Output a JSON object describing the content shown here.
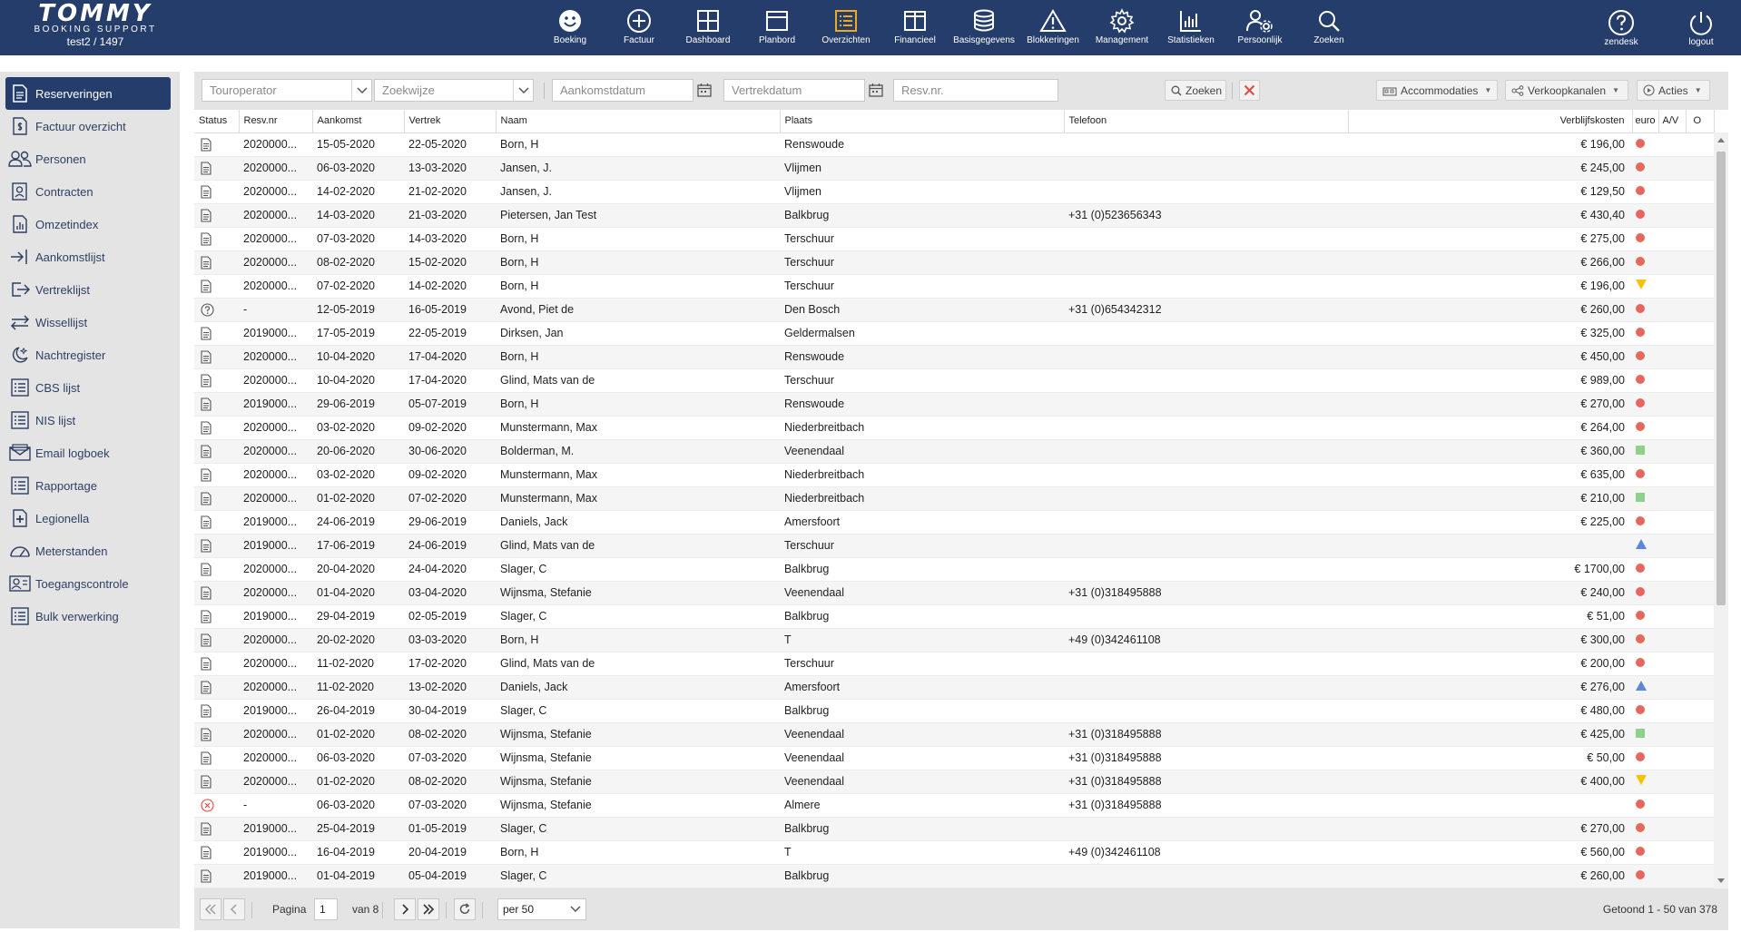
{
  "app": {
    "logo_title": "TOMMY",
    "logo_subtitle": "BOOKING SUPPORT",
    "user": "test2 / 1497"
  },
  "nav": [
    {
      "label": "Boeking",
      "icon": "smiley-icon"
    },
    {
      "label": "Factuur",
      "icon": "plus-circle-icon"
    },
    {
      "label": "Dashboard",
      "icon": "grid-icon"
    },
    {
      "label": "Planbord",
      "icon": "planbord-icon"
    },
    {
      "label": "Overzichten",
      "icon": "list-icon",
      "active": true
    },
    {
      "label": "Financieel",
      "icon": "columns-icon"
    },
    {
      "label": "Basisgegevens",
      "icon": "database-icon"
    },
    {
      "label": "Blokkeringen",
      "icon": "warning-icon"
    },
    {
      "label": "Management",
      "icon": "gear-icon"
    },
    {
      "label": "Statistieken",
      "icon": "bar-chart-icon"
    },
    {
      "label": "Persoonlijk",
      "icon": "person-gear-icon"
    },
    {
      "label": "Zoeken",
      "icon": "search-icon"
    }
  ],
  "nav_right": [
    {
      "label": "zendesk",
      "icon": "help-icon"
    },
    {
      "label": "logout",
      "icon": "power-icon"
    }
  ],
  "sidebar": [
    {
      "label": "Reserveringen",
      "icon": "document-icon",
      "active": true
    },
    {
      "label": "Factuur overzicht",
      "icon": "invoice-icon"
    },
    {
      "label": "Personen",
      "icon": "people-icon"
    },
    {
      "label": "Contracten",
      "icon": "contract-icon"
    },
    {
      "label": "Omzetindex",
      "icon": "chart-doc-icon"
    },
    {
      "label": "Aankomstlijst",
      "icon": "arrival-icon"
    },
    {
      "label": "Vertreklijst",
      "icon": "departure-icon"
    },
    {
      "label": "Wissellijst",
      "icon": "swap-icon"
    },
    {
      "label": "Nachtregister",
      "icon": "night-icon"
    },
    {
      "label": "CBS lijst",
      "icon": "list-icon"
    },
    {
      "label": "NIS lijst",
      "icon": "list-icon"
    },
    {
      "label": "Email logboek",
      "icon": "email-icon"
    },
    {
      "label": "Rapportage",
      "icon": "list-icon"
    },
    {
      "label": "Legionella",
      "icon": "plus-doc-icon"
    },
    {
      "label": "Meterstanden",
      "icon": "gauge-icon"
    },
    {
      "label": "Toegangscontrole",
      "icon": "access-icon"
    },
    {
      "label": "Bulk verwerking",
      "icon": "list-icon"
    }
  ],
  "filters": {
    "touroperator": "Touroperator",
    "zoekwijze": "Zoekwijze",
    "aankomstdatum": "Aankomstdatum",
    "vertrekdatum": "Vertrekdatum",
    "resvnr": "Resv.nr.",
    "zoeken": "Zoeken",
    "accommodaties": "Accommodaties",
    "verkoopkanalen": "Verkoopkanalen",
    "acties": "Acties"
  },
  "columns": {
    "status": "Status",
    "resvnr": "Resv.nr",
    "aankomst": "Aankomst",
    "vertrek": "Vertrek",
    "naam": "Naam",
    "plaats": "Plaats",
    "telefoon": "Telefoon",
    "verblijfskosten": "Verblijfskosten",
    "euro": "euro",
    "av": "A/V",
    "o": "O"
  },
  "rows": [
    {
      "status": "doc",
      "resv": "2020000...",
      "aankomst": "15-05-2020",
      "vertrek": "22-05-2020",
      "naam": "Born, H",
      "plaats": "Renswoude",
      "telefoon": "",
      "kosten": "€ 196,00",
      "euro": "dot"
    },
    {
      "status": "doc",
      "resv": "2020000...",
      "aankomst": "06-03-2020",
      "vertrek": "13-03-2020",
      "naam": "Jansen, J.",
      "plaats": "Vlijmen",
      "telefoon": "",
      "kosten": "€ 245,00",
      "euro": "dot"
    },
    {
      "status": "doc",
      "resv": "2020000...",
      "aankomst": "14-02-2020",
      "vertrek": "21-02-2020",
      "naam": "Jansen, J.",
      "plaats": "Vlijmen",
      "telefoon": "",
      "kosten": "€ 129,50",
      "euro": "dot"
    },
    {
      "status": "doc",
      "resv": "2020000...",
      "aankomst": "14-03-2020",
      "vertrek": "21-03-2020",
      "naam": "Pietersen, Jan Test",
      "plaats": "Balkbrug",
      "telefoon": "+31 (0)523656343",
      "kosten": "€ 430,40",
      "euro": "dot"
    },
    {
      "status": "doc",
      "resv": "2020000...",
      "aankomst": "07-03-2020",
      "vertrek": "14-03-2020",
      "naam": "Born, H",
      "plaats": "Terschuur",
      "telefoon": "",
      "kosten": "€ 275,00",
      "euro": "dot"
    },
    {
      "status": "doc",
      "resv": "2020000...",
      "aankomst": "08-02-2020",
      "vertrek": "15-02-2020",
      "naam": "Born, H",
      "plaats": "Terschuur",
      "telefoon": "",
      "kosten": "€ 266,00",
      "euro": "dot"
    },
    {
      "status": "doc",
      "resv": "2020000...",
      "aankomst": "07-02-2020",
      "vertrek": "14-02-2020",
      "naam": "Born, H",
      "plaats": "Terschuur",
      "telefoon": "",
      "kosten": "€ 196,00",
      "euro": "tri-down"
    },
    {
      "status": "question",
      "resv": "-",
      "aankomst": "12-05-2019",
      "vertrek": "16-05-2019",
      "naam": "Avond, Piet de",
      "plaats": "Den Bosch",
      "telefoon": "+31 (0)654342312",
      "kosten": "€ 260,00",
      "euro": "dot"
    },
    {
      "status": "doc",
      "resv": "2019000...",
      "aankomst": "17-05-2019",
      "vertrek": "22-05-2019",
      "naam": "Dirksen, Jan",
      "plaats": "Geldermalsen",
      "telefoon": "",
      "kosten": "€ 325,00",
      "euro": "dot"
    },
    {
      "status": "doc",
      "resv": "2020000...",
      "aankomst": "10-04-2020",
      "vertrek": "17-04-2020",
      "naam": "Born, H",
      "plaats": "Renswoude",
      "telefoon": "",
      "kosten": "€ 450,00",
      "euro": "dot"
    },
    {
      "status": "doc",
      "resv": "2020000...",
      "aankomst": "10-04-2020",
      "vertrek": "17-04-2020",
      "naam": "Glind, Mats van de",
      "plaats": "Terschuur",
      "telefoon": "",
      "kosten": "€ 989,00",
      "euro": "dot"
    },
    {
      "status": "doc",
      "resv": "2019000...",
      "aankomst": "29-06-2019",
      "vertrek": "05-07-2019",
      "naam": "Born, H",
      "plaats": "Renswoude",
      "telefoon": "",
      "kosten": "€ 270,00",
      "euro": "dot"
    },
    {
      "status": "doc",
      "resv": "2020000...",
      "aankomst": "03-02-2020",
      "vertrek": "09-02-2020",
      "naam": "Munstermann, Max",
      "plaats": "Niederbreitbach",
      "telefoon": "",
      "kosten": "€ 264,00",
      "euro": "dot"
    },
    {
      "status": "doc",
      "resv": "2020000...",
      "aankomst": "20-06-2020",
      "vertrek": "30-06-2020",
      "naam": "Bolderman, M.",
      "plaats": "Veenendaal",
      "telefoon": "",
      "kosten": "€ 360,00",
      "euro": "sq"
    },
    {
      "status": "doc",
      "resv": "2020000...",
      "aankomst": "03-02-2020",
      "vertrek": "09-02-2020",
      "naam": "Munstermann, Max",
      "plaats": "Niederbreitbach",
      "telefoon": "",
      "kosten": "€ 635,00",
      "euro": "dot"
    },
    {
      "status": "doc",
      "resv": "2020000...",
      "aankomst": "01-02-2020",
      "vertrek": "07-02-2020",
      "naam": "Munstermann, Max",
      "plaats": "Niederbreitbach",
      "telefoon": "",
      "kosten": "€ 210,00",
      "euro": "sq"
    },
    {
      "status": "doc",
      "resv": "2019000...",
      "aankomst": "24-06-2019",
      "vertrek": "29-06-2019",
      "naam": "Daniels, Jack",
      "plaats": "Amersfoort",
      "telefoon": "",
      "kosten": "€ 225,00",
      "euro": "dot"
    },
    {
      "status": "doc",
      "resv": "2019000...",
      "aankomst": "17-06-2019",
      "vertrek": "24-06-2019",
      "naam": "Glind, Mats van de",
      "plaats": "Terschuur",
      "telefoon": "",
      "kosten": "",
      "euro": "tri-up"
    },
    {
      "status": "doc",
      "resv": "2020000...",
      "aankomst": "20-04-2020",
      "vertrek": "24-04-2020",
      "naam": "Slager, C",
      "plaats": "Balkbrug",
      "telefoon": "",
      "kosten": "€ 1700,00",
      "euro": "dot"
    },
    {
      "status": "doc",
      "resv": "2020000...",
      "aankomst": "01-04-2020",
      "vertrek": "03-04-2020",
      "naam": "Wijnsma, Stefanie",
      "plaats": "Veenendaal",
      "telefoon": "+31 (0)318495888",
      "kosten": "€ 240,00",
      "euro": "dot"
    },
    {
      "status": "doc",
      "resv": "2019000...",
      "aankomst": "29-04-2019",
      "vertrek": "02-05-2019",
      "naam": "Slager, C",
      "plaats": "Balkbrug",
      "telefoon": "",
      "kosten": "€ 51,00",
      "euro": "dot"
    },
    {
      "status": "doc",
      "resv": "2020000...",
      "aankomst": "20-02-2020",
      "vertrek": "03-03-2020",
      "naam": "Born, H",
      "plaats": "T",
      "telefoon": "+49 (0)342461108",
      "kosten": "€ 300,00",
      "euro": "dot"
    },
    {
      "status": "doc",
      "resv": "2020000...",
      "aankomst": "11-02-2020",
      "vertrek": "17-02-2020",
      "naam": "Glind, Mats van de",
      "plaats": "Terschuur",
      "telefoon": "",
      "kosten": "€ 200,00",
      "euro": "dot"
    },
    {
      "status": "doc",
      "resv": "2020000...",
      "aankomst": "11-02-2020",
      "vertrek": "13-02-2020",
      "naam": "Daniels, Jack",
      "plaats": "Amersfoort",
      "telefoon": "",
      "kosten": "€ 276,00",
      "euro": "tri-up"
    },
    {
      "status": "doc",
      "resv": "2019000...",
      "aankomst": "26-04-2019",
      "vertrek": "30-04-2019",
      "naam": "Slager, C",
      "plaats": "Balkbrug",
      "telefoon": "",
      "kosten": "€ 480,00",
      "euro": "dot"
    },
    {
      "status": "doc",
      "resv": "2020000...",
      "aankomst": "01-02-2020",
      "vertrek": "08-02-2020",
      "naam": "Wijnsma, Stefanie",
      "plaats": "Veenendaal",
      "telefoon": "+31 (0)318495888",
      "kosten": "€ 425,00",
      "euro": "sq"
    },
    {
      "status": "doc",
      "resv": "2020000...",
      "aankomst": "06-03-2020",
      "vertrek": "07-03-2020",
      "naam": "Wijnsma, Stefanie",
      "plaats": "Veenendaal",
      "telefoon": "+31 (0)318495888",
      "kosten": "€ 50,00",
      "euro": "dot"
    },
    {
      "status": "doc",
      "resv": "2020000...",
      "aankomst": "01-02-2020",
      "vertrek": "08-02-2020",
      "naam": "Wijnsma, Stefanie",
      "plaats": "Veenendaal",
      "telefoon": "+31 (0)318495888",
      "kosten": "€ 400,00",
      "euro": "tri-down"
    },
    {
      "status": "cancel",
      "resv": "-",
      "aankomst": "06-03-2020",
      "vertrek": "07-03-2020",
      "naam": "Wijnsma, Stefanie",
      "plaats": "Almere",
      "telefoon": "+31 (0)318495888",
      "kosten": "",
      "euro": "dot"
    },
    {
      "status": "doc",
      "resv": "2019000...",
      "aankomst": "25-04-2019",
      "vertrek": "01-05-2019",
      "naam": "Slager, C",
      "plaats": "Balkbrug",
      "telefoon": "",
      "kosten": "€ 270,00",
      "euro": "dot"
    },
    {
      "status": "doc",
      "resv": "2019000...",
      "aankomst": "16-04-2019",
      "vertrek": "20-04-2019",
      "naam": "Born, H",
      "plaats": "T",
      "telefoon": "+49 (0)342461108",
      "kosten": "€ 560,00",
      "euro": "dot"
    },
    {
      "status": "doc",
      "resv": "2019000...",
      "aankomst": "01-04-2019",
      "vertrek": "05-04-2019",
      "naam": "Slager, C",
      "plaats": "Balkbrug",
      "telefoon": "",
      "kosten": "€ 260,00",
      "euro": "dot"
    }
  ],
  "pager": {
    "pagina_label": "Pagina",
    "page": "1",
    "van_label": "van 8",
    "per_page": "per 50",
    "count": "Getoond 1 - 50 van 378"
  },
  "colors": {
    "topbar": "#253d6b",
    "active_icon": "#f0a81d",
    "dot_red": "#e8675d",
    "square_green": "#8fd18a",
    "triangle_yellow": "#f4c400",
    "triangle_blue": "#5b86d9"
  }
}
